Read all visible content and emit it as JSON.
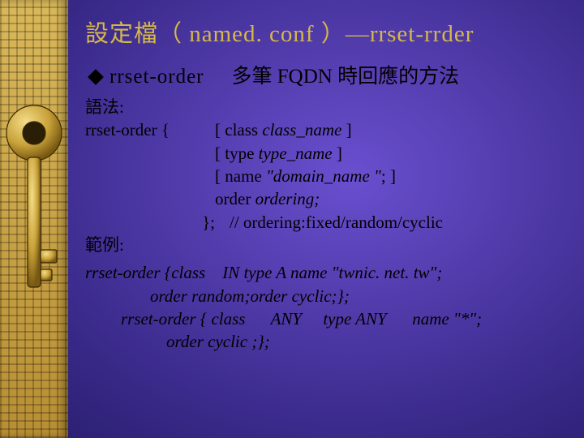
{
  "title": "設定檔（ named. conf ）—rrset-rrder",
  "heading": {
    "term": "rrset-order",
    "desc": "多筆 FQDN 時回應的方法"
  },
  "syntax_label": "語法:",
  "syntax_key": "rrset-order {",
  "syntax_lines": [
    {
      "plain": "[ class ",
      "it": "class_name",
      "tail": " ]"
    },
    {
      "plain": "[ type  ",
      "it": "type_name",
      "tail": " ]"
    },
    {
      "plain": "[ name ",
      "it": "\"domain_name \"",
      "tail": "; ]"
    },
    {
      "plain": "order ",
      "it": "ordering;",
      "tail": ""
    }
  ],
  "syntax_close": "};",
  "syntax_comment": "// ordering:fixed/random/cyclic",
  "example_label": "範例:",
  "example": {
    "l1": "rrset-order {class    IN type A name \"twnic. net. tw\";",
    "l2": "order random;order cyclic;};",
    "l3": "rrset-order { class      ANY     type ANY      name \"*\";",
    "l4": "order cyclic ;};"
  }
}
